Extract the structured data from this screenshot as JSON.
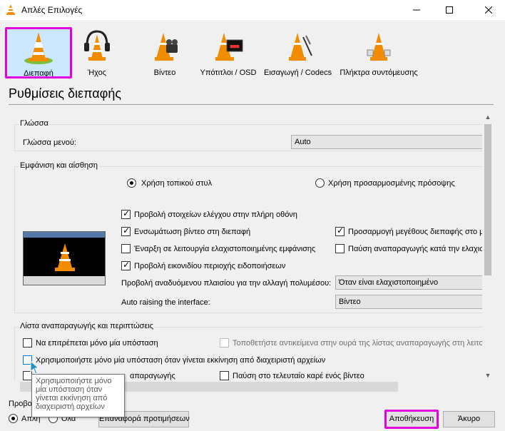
{
  "window": {
    "title": "Απλές Επιλογές",
    "icon": "vlc-cone-icon"
  },
  "categories": [
    {
      "label": "Διεπαφή",
      "icon": "interface-cone-icon",
      "selected": true
    },
    {
      "label": "Ήχος",
      "icon": "audio-headphones-icon",
      "selected": false
    },
    {
      "label": "Βίντεο",
      "icon": "video-cone-icon",
      "selected": false
    },
    {
      "label": "Υπότιτλοι / OSD",
      "icon": "subtitles-cone-icon",
      "selected": false
    },
    {
      "label": "Εισαγωγή / Codecs",
      "icon": "input-codecs-cone-icon",
      "selected": false
    },
    {
      "label": "Πλήκτρα συντόμευσης",
      "icon": "hotkeys-cone-icon",
      "selected": false
    }
  ],
  "page": {
    "title": "Ρυθμίσεις διεπαφής"
  },
  "language": {
    "group_title": "Γλώσσα",
    "menu_language_label": "Γλώσσα μενού:",
    "menu_language_value": "Auto"
  },
  "look": {
    "group_title": "Εμφάνιση και αίσθηση",
    "radio_native": "Χρήση τοπικού στυλ",
    "radio_custom": "Χρήση προσαρμοσμένης πρόσοψης",
    "cb_fullscreen_controls": "Προβολή στοιχείων ελέγχου στην πλήρη οθόνη",
    "cb_embed_video": "Ενσωμάτωση βίντεο στη διεπαφή",
    "cb_resize_interface": "Προσαρμογή μεγέθους διεπαφής στο μ",
    "cb_minimal_mode": "Έναρξη σε λειτουργία ελαχιστοποιημένης εμφάνισης",
    "cb_pause_minimized": "Παύση αναπαραγωγής κατά την ελαχισ",
    "cb_systray": "Προβολή εικονιδίου περιοχής ειδοποιήσεων",
    "media_change_label": "Προβολή αναδυόμενου πλαισίου για την αλλαγή πολυμέσου:",
    "media_change_value": "Όταν είναι ελαχιστοποιημένο",
    "auto_raise_label": "Auto raising the interface:",
    "auto_raise_value": "Βίντεο"
  },
  "playlist": {
    "group_title": "Λίστα αναπαραγωγής και περιπτώσεις",
    "cb_one_instance": "Να επιτρέπεται μόνο μία υπόσταση",
    "cb_enqueue": "Τοποθετήστε αντικείμενα στην ουρά της λίστας αναπαραγωγής στη λειτου",
    "cb_one_instance_file_manager": "Χρησιμοποιήστε μόνο μία υπόσταση όταν γίνεται εκκίνηση από διαχειριστή αρχείων",
    "cb_hidden_partial": "απαραγωγής",
    "cb_pause_last_frame": "Παύση στο τελευταίο καρέ ενός βίντεο"
  },
  "tooltip": {
    "line1": "Χρησιμοποιήστε μόνο",
    "line2": "μία υπόσταση όταν",
    "line3": "γίνεται εκκίνηση από",
    "line4": "διαχειριστή αρχείων"
  },
  "footer": {
    "show_settings_label": "Προβο",
    "radio_simple": "Απλή",
    "radio_all": "Όλα",
    "reset_button": "Επαναφορά προτιμήσεων",
    "save_button": "Αποθήκευση",
    "cancel_button": "Άκυρο"
  },
  "colors": {
    "highlight": "#e000e0",
    "selected_bg": "#cce8ff",
    "accent": "#0078d7",
    "cone_orange": "#f28c00"
  }
}
